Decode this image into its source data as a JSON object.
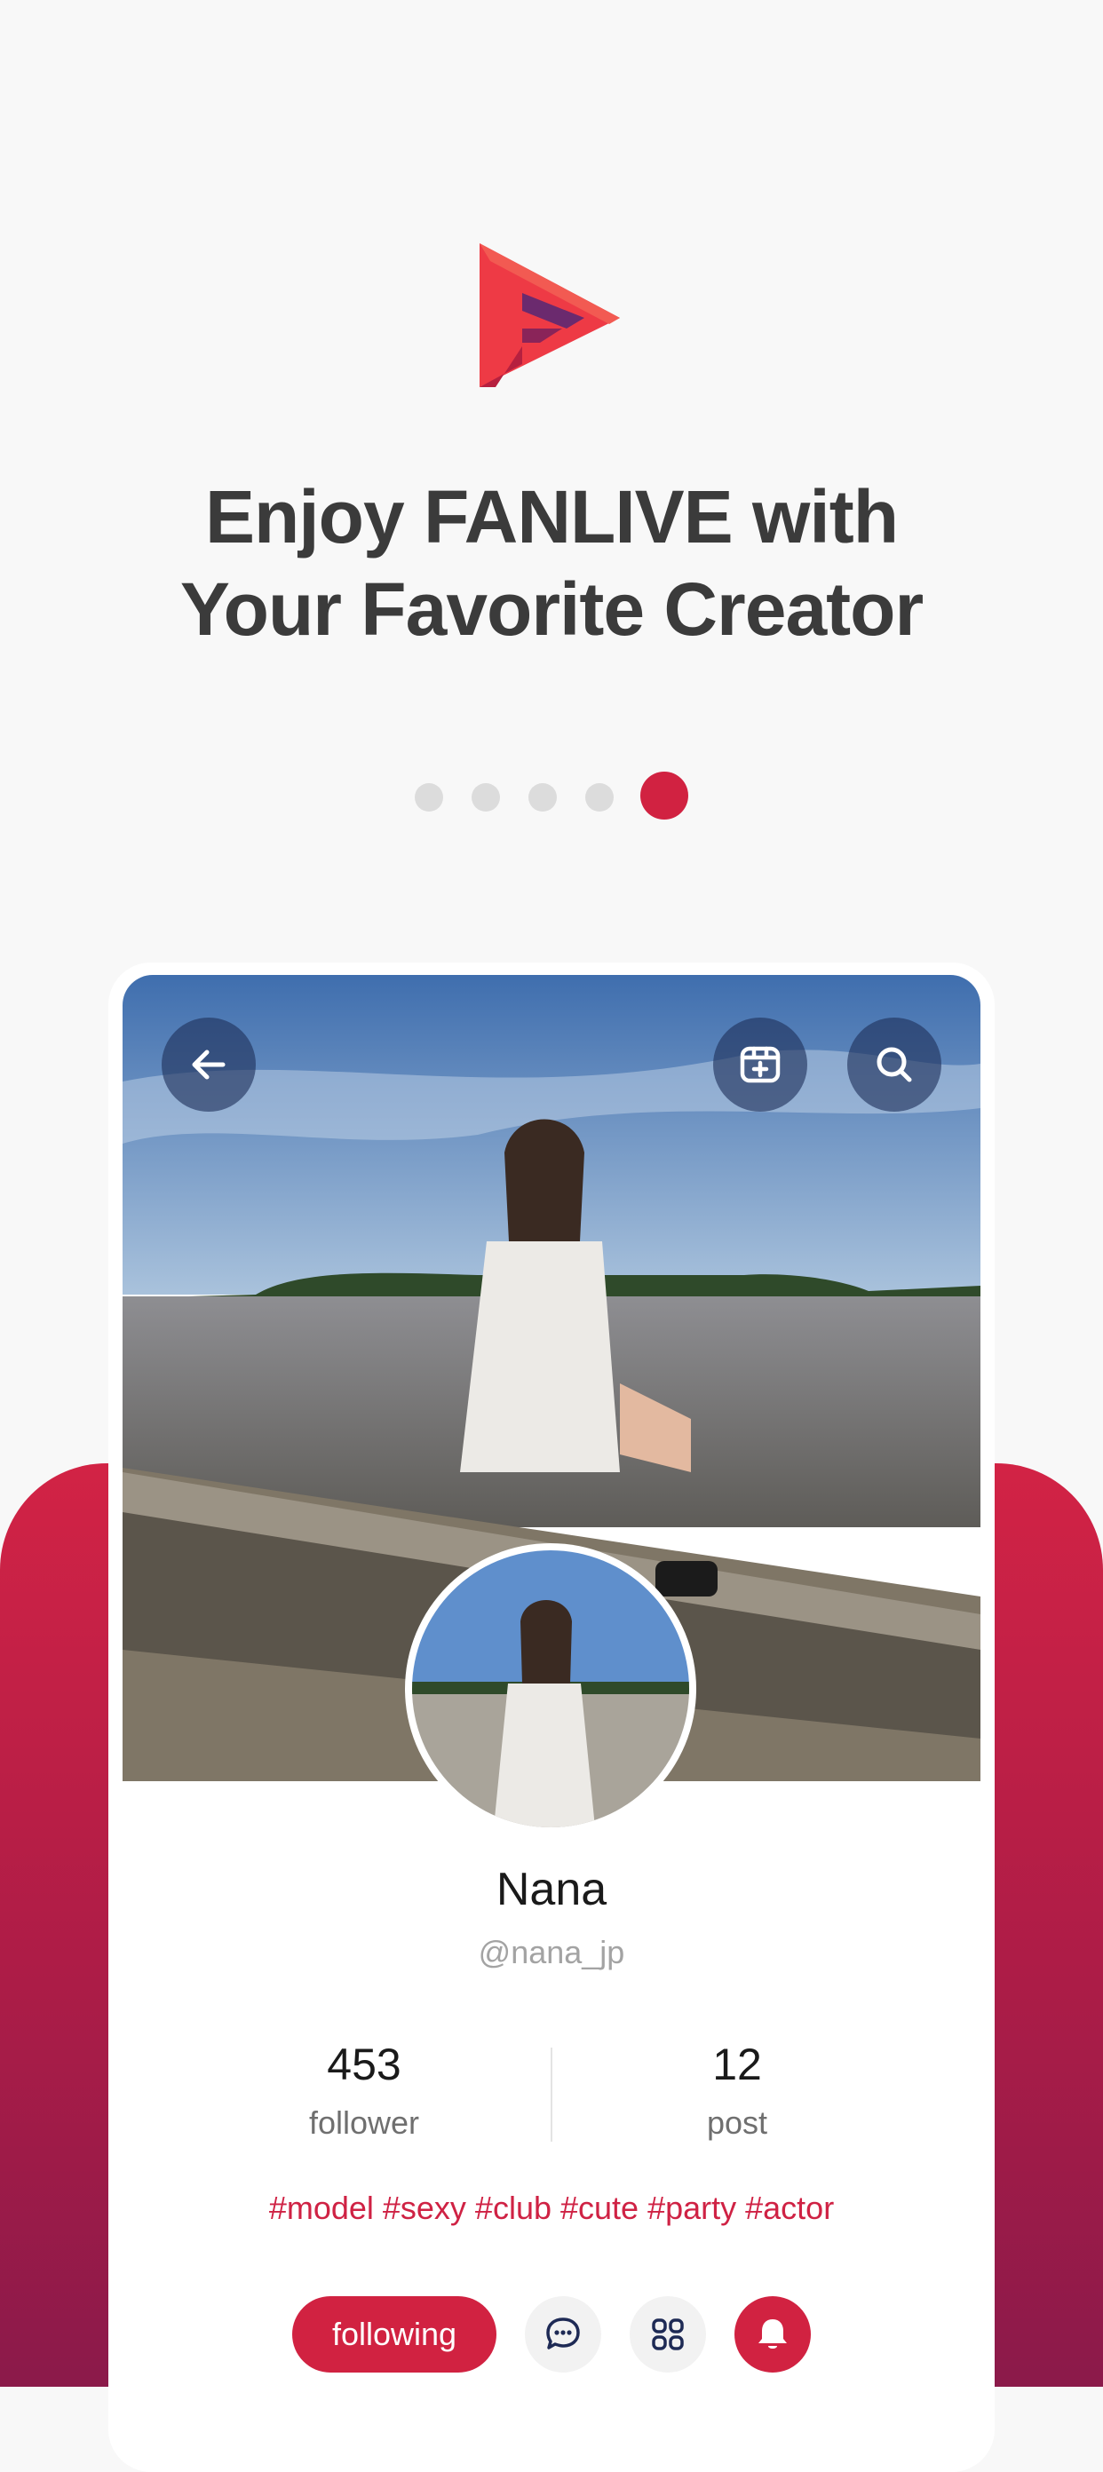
{
  "onboarding": {
    "headline_line1": "Enjoy FANLIVE with",
    "headline_line2": "Your Favorite Creator",
    "pagination": {
      "total": 5,
      "active_index": 4
    },
    "logo_icon": "fanlive-logo"
  },
  "profile_preview": {
    "top_bar": {
      "back_icon": "arrow-left-icon",
      "shop_icon": "shop-icon",
      "search_icon": "search-icon"
    },
    "name": "Nana",
    "handle": "@nana_jp",
    "stats": [
      {
        "value": "453",
        "label": "follower"
      },
      {
        "value": "12",
        "label": "post"
      }
    ],
    "tags": "#model #sexy #club #cute #party #actor",
    "actions": {
      "follow_label": "following",
      "message_icon": "chat-icon",
      "apps_icon": "grid-icon",
      "notify_icon": "bell-icon"
    }
  },
  "colors": {
    "accent": "#d12241",
    "headline": "#3b3b3b",
    "background": "#f8f8f8",
    "dot_inactive": "#dcdcdc"
  }
}
